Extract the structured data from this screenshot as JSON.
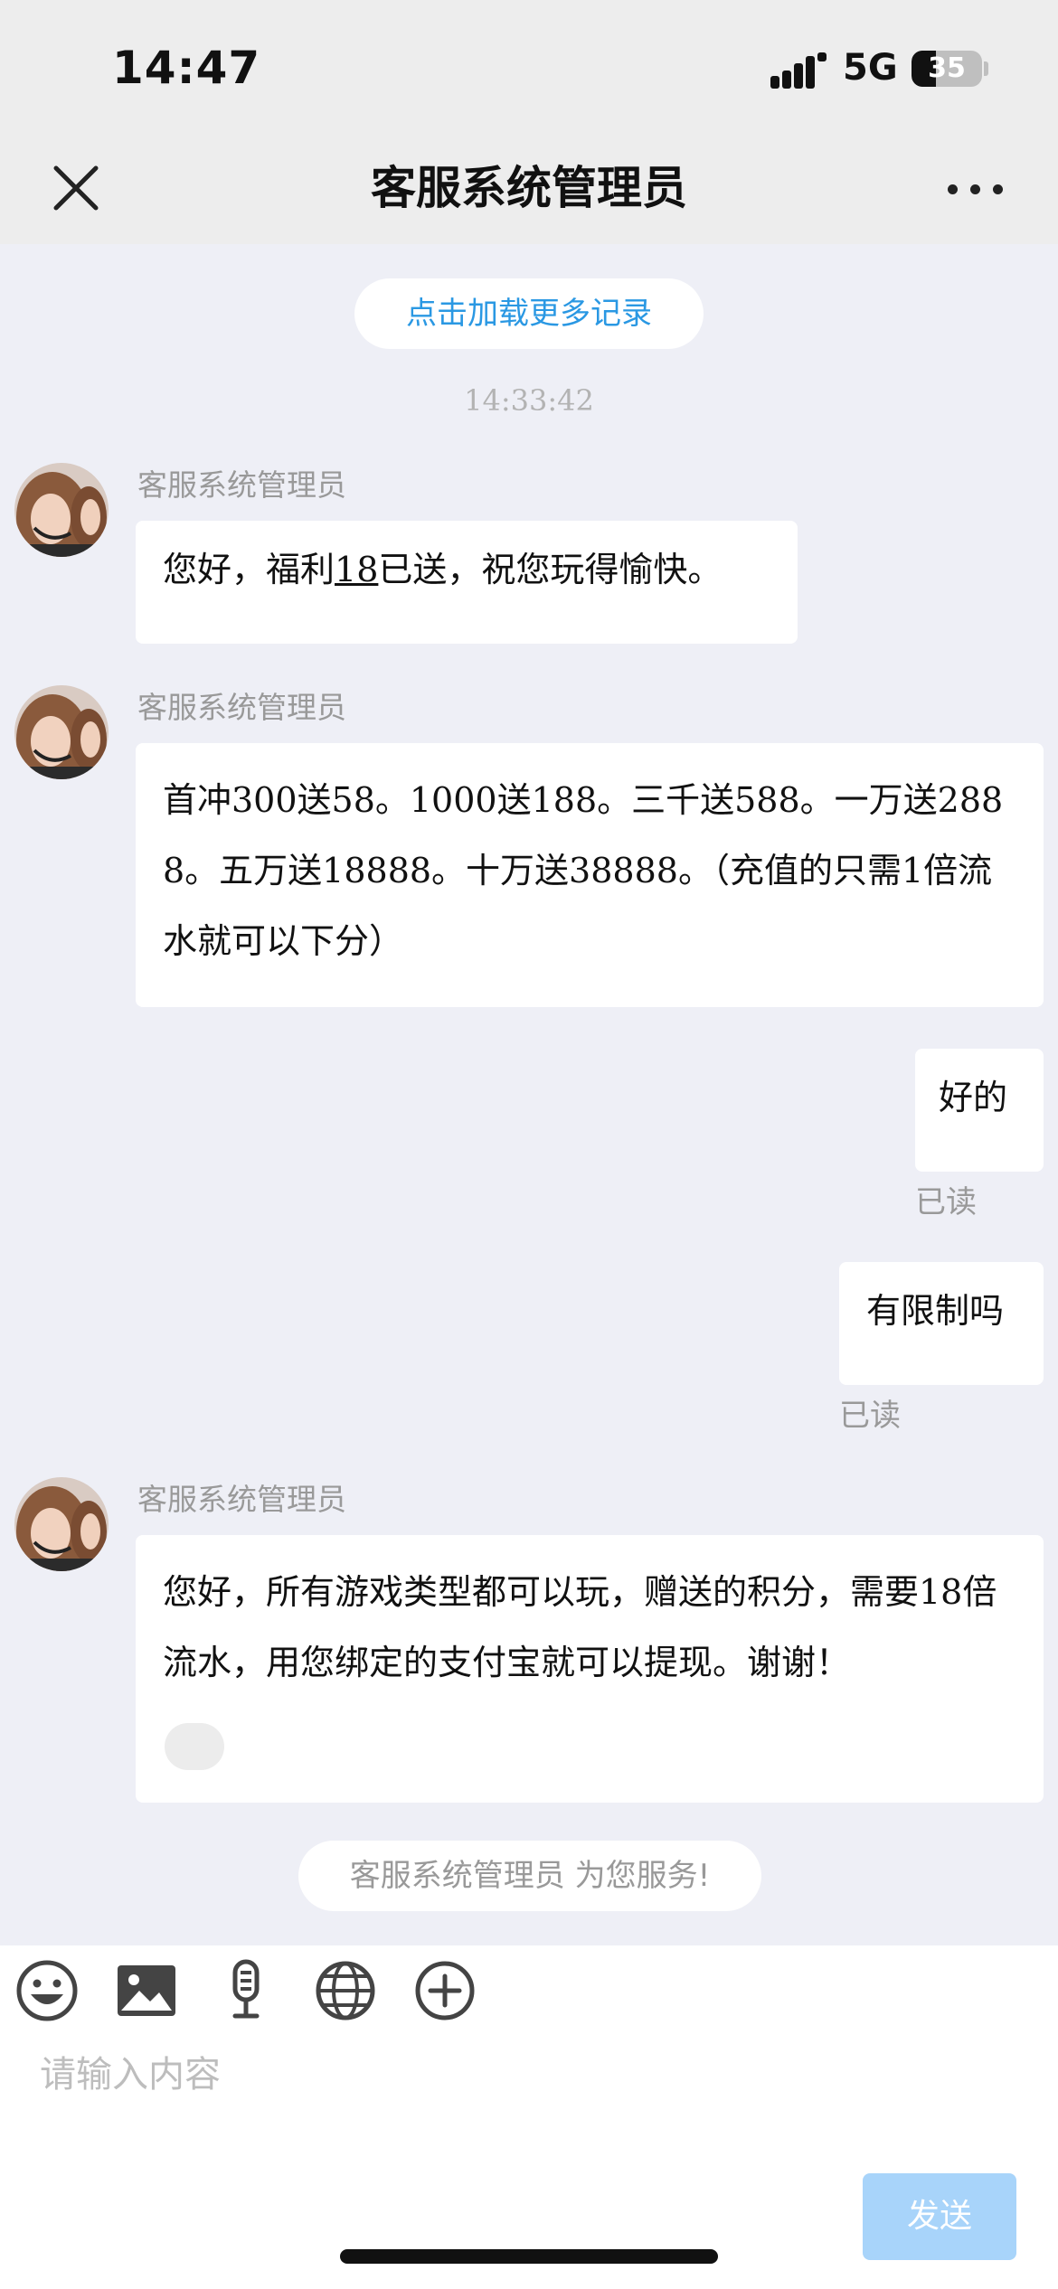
{
  "status_bar": {
    "time": "14:47",
    "network": "5G",
    "battery": "35",
    "battery_level": 0.35
  },
  "nav": {
    "title": "客服系统管理员"
  },
  "chat": {
    "load_more": "点击加载更多记录",
    "timestamp": "14:33:42",
    "messages": [
      {
        "from": "agent",
        "sender": "客服系统管理员",
        "parts": [
          "您好，福利",
          "18",
          "已送，祝您玩得愉快。"
        ]
      },
      {
        "from": "agent",
        "sender": "客服系统管理员",
        "text": "首冲300送58。1000送188。三千送588。一万送2888。五万送18888。十万送38888。（充值的只需1倍流水就可以下分）"
      },
      {
        "from": "user",
        "text": "好的",
        "status": "已读"
      },
      {
        "from": "user",
        "text": "有限制吗",
        "status": "已读"
      },
      {
        "from": "agent",
        "sender": "客服系统管理员",
        "text": "您好，所有游戏类型都可以玩，赠送的积分，需要18倍流水，用您绑定的支付宝就可以提现。谢谢！"
      }
    ],
    "service_notice": "客服系统管理员 为您服务!"
  },
  "toolbar": {
    "icons": [
      "emoji-icon",
      "image-icon",
      "microphone-icon",
      "globe-icon",
      "plus-icon"
    ]
  },
  "input": {
    "placeholder": "请输入内容",
    "value": ""
  },
  "send_button": {
    "label": "发送"
  },
  "colors": {
    "accent": "#2a98e3",
    "send_disabled": "#a8d4fa",
    "chat_bg": "#eeeff6"
  }
}
